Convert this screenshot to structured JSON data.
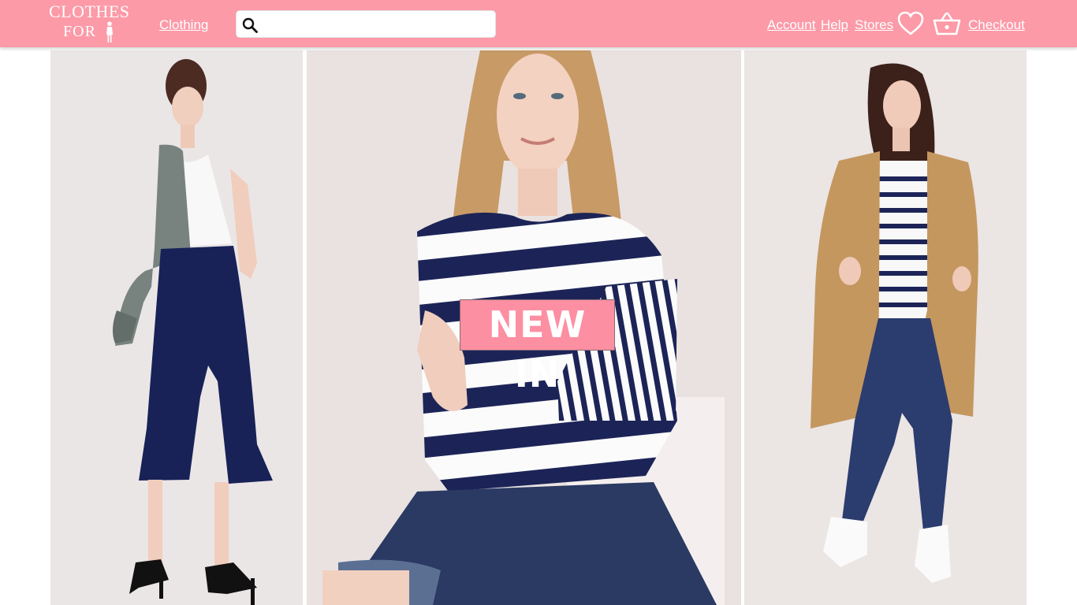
{
  "header": {
    "logo": {
      "line1": "CLOTHES",
      "line2": "FOR"
    },
    "nav": {
      "clothing": "Clothing",
      "account": "Account",
      "help": "Help",
      "stores": "Stores",
      "checkout": "Checkout"
    },
    "search": {
      "placeholder": "",
      "value": "",
      "icon": "search-icon"
    },
    "icons": {
      "wishlist": "heart-icon",
      "basket": "basket-icon"
    }
  },
  "hero": {
    "badge": "NEW IN",
    "panels": [
      {
        "name": "model-cropped-trousers"
      },
      {
        "name": "model-striped-top"
      },
      {
        "name": "model-trench-coat"
      }
    ]
  },
  "colors": {
    "brand_pink": "#fc9aa8",
    "badge_pink": "#fc8fa2",
    "text_on_brand": "#ffffff",
    "navy": "#1c2457"
  }
}
